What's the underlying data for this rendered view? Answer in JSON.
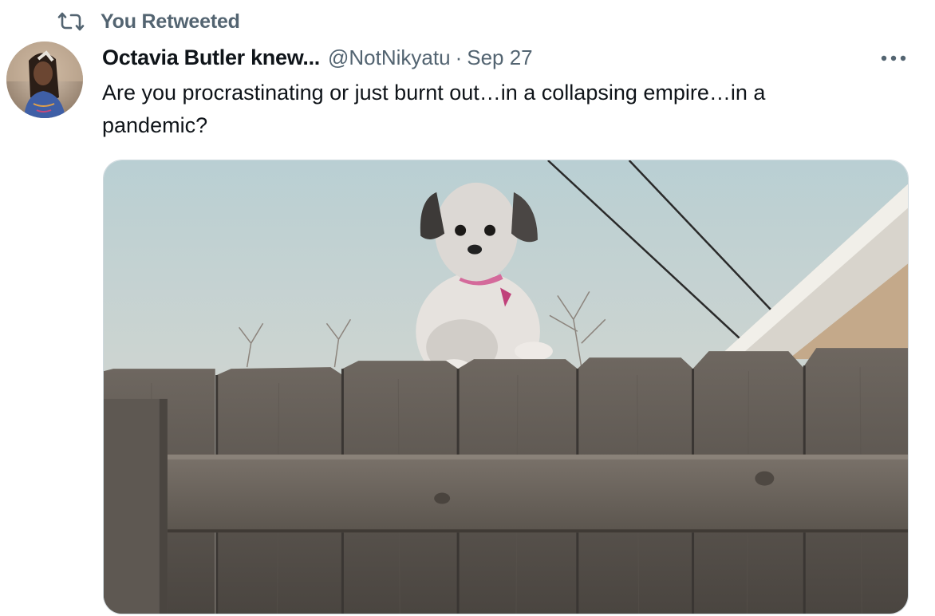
{
  "retweet": {
    "icon": "retweet-icon",
    "label": "You Retweeted"
  },
  "author": {
    "name": "Octavia Butler knew...",
    "handle": "@NotNikyatu",
    "separator": "·",
    "date": "Sep 27",
    "avatar": "avatar"
  },
  "tweet": {
    "text": "Are you procrastinating or just burnt out…in a collapsing empire…in a pandemic?",
    "more_icon": "more-options-icon"
  },
  "media": {
    "type": "photo",
    "subject": "dog-over-fence"
  },
  "colors": {
    "text": "#0f1419",
    "secondary": "#536471",
    "border": "#cfd9de"
  }
}
